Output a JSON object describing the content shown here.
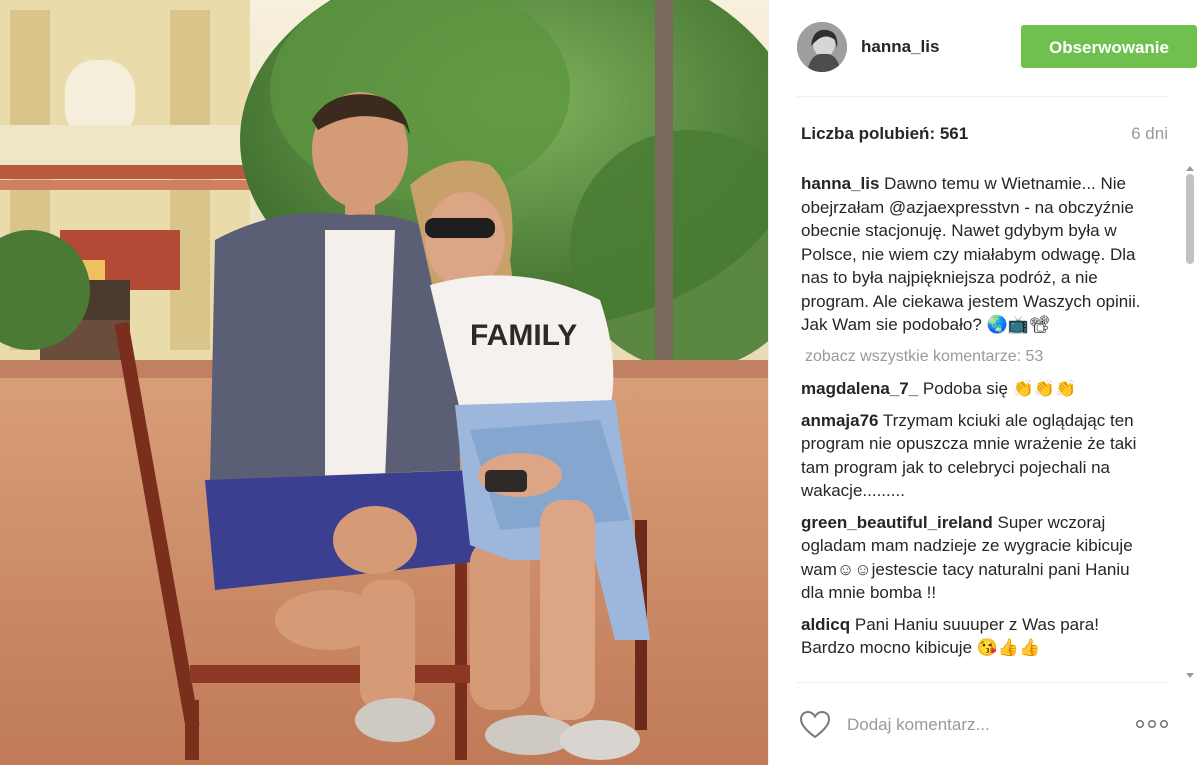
{
  "post": {
    "author": "hanna_lis",
    "follow_label": "Obserwowanie",
    "likes_text": "Liczba polubień: 561",
    "age_text": "6 dni",
    "view_all_comments": "zobacz wszystkie komentarze: 53",
    "add_comment_placeholder": "Dodaj komentarz...",
    "follow_color": "#70c050",
    "photo_shirt_text": "FAMILY"
  },
  "caption": {
    "username": "hanna_lis",
    "text": "Dawno temu w Wietnamie... Nie obejrzałam @azjaexpresstvn - na obczyźnie obecnie stacjonuję. Nawet gdybym była w Polsce, nie wiem czy miałabym odwagę. Dla nas to była najpiękniejsza podróż, a nie program. Ale ciekawa jestem Waszych opinii. Jak Wam sie podobało? 🌏📺📽"
  },
  "comments": [
    {
      "username": "magdalena_7_",
      "text": "Podoba się 👏👏👏"
    },
    {
      "username": "anmaja76",
      "text": "Trzymam kciuki ale oglądając ten program nie opuszcza mnie wrażenie że taki tam program jak to celebryci pojechali na wakacje........."
    },
    {
      "username": "green_beautiful_ireland",
      "text": "Super wczoraj ogladam mam nadzieje ze wygracie kibicuje wam☺☺jestescie tacy naturalni pani Haniu dla mnie bomba !!"
    },
    {
      "username": "aldicq",
      "text": "Pani Haniu suuuper z Was para! Bardzo mocno kibicuje 😘👍👍"
    }
  ],
  "icons": {
    "like": "heart-outline",
    "more": "three-dots",
    "avatar": "user-avatar"
  }
}
